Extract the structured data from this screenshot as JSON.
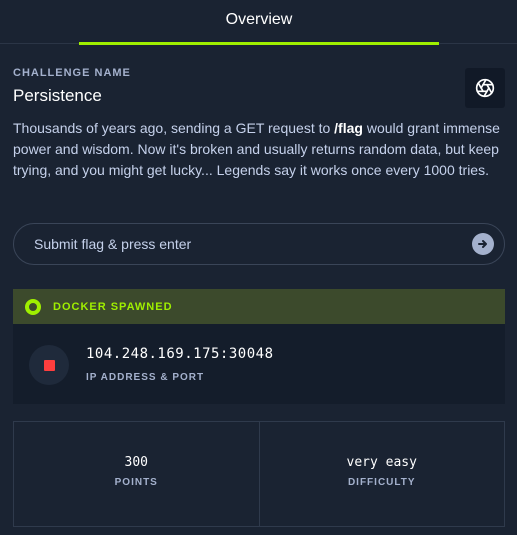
{
  "tabs": [
    {
      "label": "Overview",
      "active": true
    }
  ],
  "challenge": {
    "eyebrow": "CHALLENGE NAME",
    "name": "Persistence",
    "description_before": "Thousands of years ago, sending a GET request to ",
    "description_bold": "/flag",
    "description_after": " would grant immense power and wisdom. Now it's broken and usually returns random data, but keep trying, and you might get lucky... Legends say it works once every 1000 tries.",
    "logo_icon": "aperture-icon"
  },
  "flag_input": {
    "placeholder": "Submit flag & press enter",
    "value": "",
    "submit_icon": "arrow-right-icon"
  },
  "docker": {
    "status": "DOCKER SPAWNED",
    "status_color": "#9fef00"
  },
  "instance": {
    "ip_port": "104.248.169.175:30048",
    "label": "IP ADDRESS & PORT",
    "stop_icon": "stop-icon"
  },
  "stats": [
    {
      "value": "300",
      "label": "POINTS"
    },
    {
      "value": "very easy",
      "label": "DIFFICULTY"
    }
  ],
  "colors": {
    "accent": "#9fef00",
    "background": "#1a2332",
    "stop": "#ff3e3e"
  }
}
